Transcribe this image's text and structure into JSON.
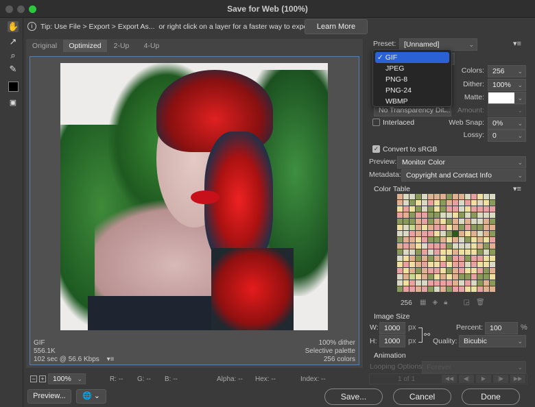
{
  "window": {
    "title": "Save for Web (100%)"
  },
  "tip": {
    "text": "Tip: Use File > Export > Export As...  or right click on a layer for a faster way to export assets",
    "learn_more": "Learn More"
  },
  "tabs": [
    "Original",
    "Optimized",
    "2-Up",
    "4-Up"
  ],
  "active_tab": "Optimized",
  "tools": [
    "hand-icon",
    "slice-select-icon",
    "zoom-icon",
    "eyedropper-icon",
    "color-swatch-icon",
    "toggle-slices-icon"
  ],
  "image_info": {
    "format": "GIF",
    "size": "556.1K",
    "time": "102 sec @ 56.6 Kbps",
    "dither": "100% dither",
    "palette": "Selective palette",
    "colors": "256 colors"
  },
  "status": {
    "zoom": "100%",
    "r": "R: --",
    "g": "G: --",
    "b": "B: --",
    "alpha": "Alpha: --",
    "hex": "Hex: --",
    "index": "Index: --"
  },
  "buttons": {
    "preview": "Preview...",
    "save": "Save...",
    "cancel": "Cancel",
    "done": "Done"
  },
  "settings": {
    "preset_label": "Preset:",
    "preset": "[Unnamed]",
    "format_menu": [
      "GIF",
      "JPEG",
      "PNG-8",
      "PNG-24",
      "WBMP"
    ],
    "format_selected": "GIF",
    "colors_label": "Colors:",
    "colors": "256",
    "dither_label": "Dither:",
    "dither": "100%",
    "matte_label": "Matte:",
    "matte_color": "#ffffff",
    "transparency_dither": "No Transparency Dit...",
    "amount_label": "Amount:",
    "interlaced_label": "Interlaced",
    "interlaced": false,
    "websnap_label": "Web Snap:",
    "websnap": "0%",
    "lossy_label": "Lossy:",
    "lossy": "0",
    "srgb_label": "Convert to sRGB",
    "srgb": true,
    "preview_label": "Preview:",
    "preview": "Monitor Color",
    "metadata_label": "Metadata:",
    "metadata": "Copyright and Contact Info"
  },
  "color_table": {
    "title": "Color Table",
    "count": "256",
    "palette": [
      "#d9d9c4",
      "#2e5a1e",
      "#c73a2e",
      "#e9c8b8",
      "#f0e0a0",
      "#5a8a2a",
      "#1a2a1a",
      "#a8c878",
      "#e8a0a0",
      "#7a3040",
      "#3a6a3a",
      "#f4f0e8",
      "#8a9a5a",
      "#c8d890",
      "#b04050",
      "#285020",
      "#e0b090",
      "#6aa040",
      "#d04848",
      "#f8d8d8"
    ]
  },
  "image_size": {
    "title": "Image Size",
    "w_label": "W:",
    "w": "1000",
    "h_label": "H:",
    "h": "1000",
    "unit": "px",
    "percent_label": "Percent:",
    "percent": "100",
    "percent_unit": "%",
    "quality_label": "Quality:",
    "quality": "Bicubic"
  },
  "animation": {
    "title": "Animation",
    "looping_label": "Looping Options:",
    "looping": "Forever",
    "frame": "1 of 1"
  }
}
